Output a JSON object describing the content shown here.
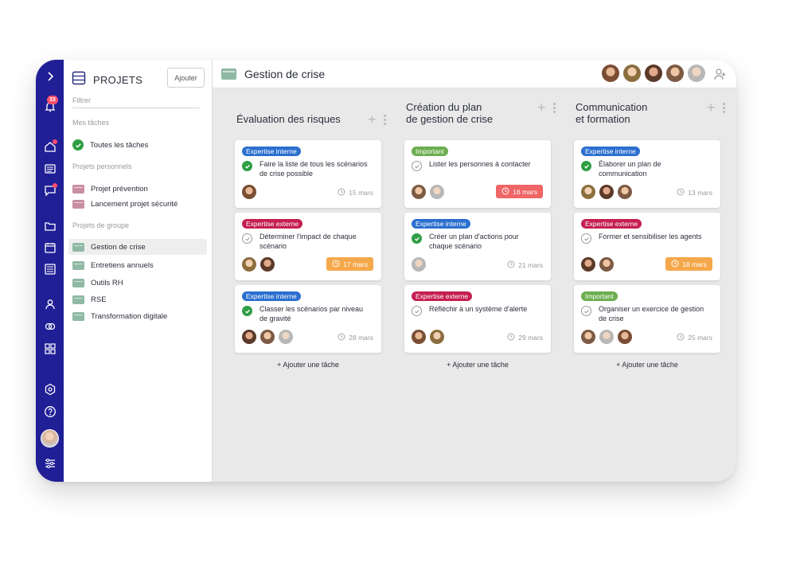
{
  "colors": {
    "rail": "#201f96",
    "tag_blue": "#2b6fcf",
    "tag_red": "#c51f52",
    "tag_green": "#6cae4f",
    "due_red": "#f06565",
    "due_orange": "#f5a84b",
    "check_green": "#2f9e44",
    "project_teal": "#8fb9a4",
    "project_pink": "#c98ea2"
  },
  "rail": {
    "notification_count": "33",
    "icons": [
      "chevron-right-icon",
      "bell-icon",
      "home-icon",
      "list-icon",
      "chat-icon",
      "folder-icon",
      "calendar-icon",
      "document-icon",
      "users-icon",
      "link-icon",
      "grid-icon",
      "settings-hex-icon",
      "help-icon",
      "avatar",
      "sliders-icon"
    ]
  },
  "panel": {
    "title": "PROJETS",
    "add_label": "Ajouter",
    "filter_placeholder": "Filtrer",
    "sections": {
      "my_tasks": "Mes tâches",
      "personal": "Projets personnels",
      "group": "Projets de groupe"
    },
    "all_tasks": "Toutes les tâches",
    "personal_projects": [
      "Projet prévention",
      "Lancement projet sécurité"
    ],
    "group_projects": [
      "Gestion de crise",
      "Entretiens annuels",
      "Outils RH",
      "RSE",
      "Transformation digitale"
    ]
  },
  "board": {
    "title": "Gestion de crise",
    "add_task_label": "+ Ajouter une tâche",
    "columns": [
      {
        "title_lines": [
          "Évaluation des risques"
        ],
        "cards": [
          {
            "tag": "Expertise interne",
            "tag_color": "#2b6fcf",
            "status": "done",
            "text": "Faire la liste de tous les scénarios de crise possible",
            "due": "15 mars",
            "due_style": "plain",
            "avatars": 1
          },
          {
            "tag": "Expertise externe",
            "tag_color": "#c51f52",
            "status": "todo",
            "text": "Déterminer l'impact de chaque scénario",
            "due": "17 mars",
            "due_style": "orange",
            "avatars": 2
          },
          {
            "tag": "Expertise interne",
            "tag_color": "#2b6fcf",
            "status": "done",
            "text": "Classer les scénarios par niveau de gravité",
            "due": "28 mars",
            "due_style": "plain",
            "avatars": 3
          }
        ]
      },
      {
        "title_lines": [
          "Création du plan",
          "de gestion de crise"
        ],
        "cards": [
          {
            "tag": "Important",
            "tag_color": "#6cae4f",
            "status": "todo",
            "text": "Lister les personnes à contacter",
            "due": "16 mars",
            "due_style": "red",
            "avatars": 2
          },
          {
            "tag": "Expertise interne",
            "tag_color": "#2b6fcf",
            "status": "done",
            "text": "Créer un plan d'actions pour chaque scénario",
            "due": "21 mars",
            "due_style": "plain",
            "avatars": 1
          },
          {
            "tag": "Expertise externe",
            "tag_color": "#c51f52",
            "status": "todo",
            "text": "Réfléchir à un système d'alerte",
            "due": "29 mars",
            "due_style": "plain",
            "avatars": 2
          }
        ]
      },
      {
        "title_lines": [
          "Communication",
          "et formation"
        ],
        "cards": [
          {
            "tag": "Expertise interne",
            "tag_color": "#2b6fcf",
            "status": "done",
            "text": "Élaborer un plan de communication",
            "due": "13 mars",
            "due_style": "plain",
            "avatars": 3
          },
          {
            "tag": "Expertise externe",
            "tag_color": "#c51f52",
            "status": "todo",
            "text": "Former et sensibiliser les agents",
            "due": "18 mars",
            "due_style": "orange",
            "avatars": 2
          },
          {
            "tag": "Important",
            "tag_color": "#6cae4f",
            "status": "todo",
            "text": "Organiser un exercice de gestion de crise",
            "due": "25 mars",
            "due_style": "plain",
            "avatars": 3
          }
        ]
      }
    ]
  }
}
